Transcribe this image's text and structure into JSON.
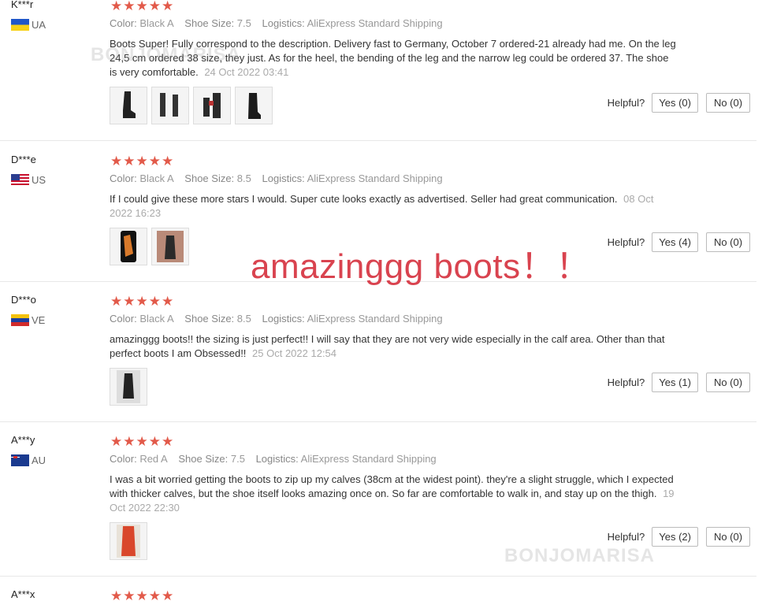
{
  "labels": {
    "color": "Color:",
    "shoe_size": "Shoe Size:",
    "logistics": "Logistics:",
    "helpful": "Helpful?"
  },
  "reviews": [
    {
      "user": "K***r",
      "country": "UA",
      "rating": "★★★★★",
      "color": "Black A",
      "shoe_size": "7.5",
      "logistics": "AliExpress Standard Shipping",
      "text": "Boots Super! Fully correspond to the description. Delivery fast to Germany, October 7 ordered-21 already had me. On the leg 24,5 cm ordered 38 size, they just. As for the heel, the bending of the leg and the narrow leg could be ordered 37. The shoe is very comfortable.",
      "date": "24 Oct 2022 03:41",
      "yes": "Yes (0)",
      "no": "No (0)"
    },
    {
      "user": "D***e",
      "country": "US",
      "rating": "★★★★★",
      "color": "Black A",
      "shoe_size": "8.5",
      "logistics": "AliExpress Standard Shipping",
      "text": "If I could give these more stars I would. Super cute looks exactly as advertised. Seller had great communication.",
      "date": "08 Oct 2022 16:23",
      "yes": "Yes (4)",
      "no": "No (0)"
    },
    {
      "user": "D***o",
      "country": "VE",
      "rating": "★★★★★",
      "color": "Black A",
      "shoe_size": "8.5",
      "logistics": "AliExpress Standard Shipping",
      "text": "amazinggg boots!! the sizing is just perfect!! I will say that they are not very wide especially in the calf area. Other than that perfect boots I am Obsessed!!",
      "date": "25 Oct 2022 12:54",
      "yes": "Yes (1)",
      "no": "No (0)"
    },
    {
      "user": "A***y",
      "country": "AU",
      "rating": "★★★★★",
      "color": "Red A",
      "shoe_size": "7.5",
      "logistics": "AliExpress Standard Shipping",
      "text": "I was a bit worried getting the boots to zip up my calves (38cm at the widest point). they're a slight struggle, which I expected with thicker calves, but the shoe itself looks amazing once on. So far are comfortable to walk in, and stay up on the thigh.",
      "date": "19 Oct 2022 22:30",
      "yes": "Yes (2)",
      "no": "No (0)"
    },
    {
      "user": "A***x",
      "rating": "★★★★★"
    }
  ],
  "overlay_caption": "amazinggg boots！！",
  "watermark": "BONJOMARISA"
}
